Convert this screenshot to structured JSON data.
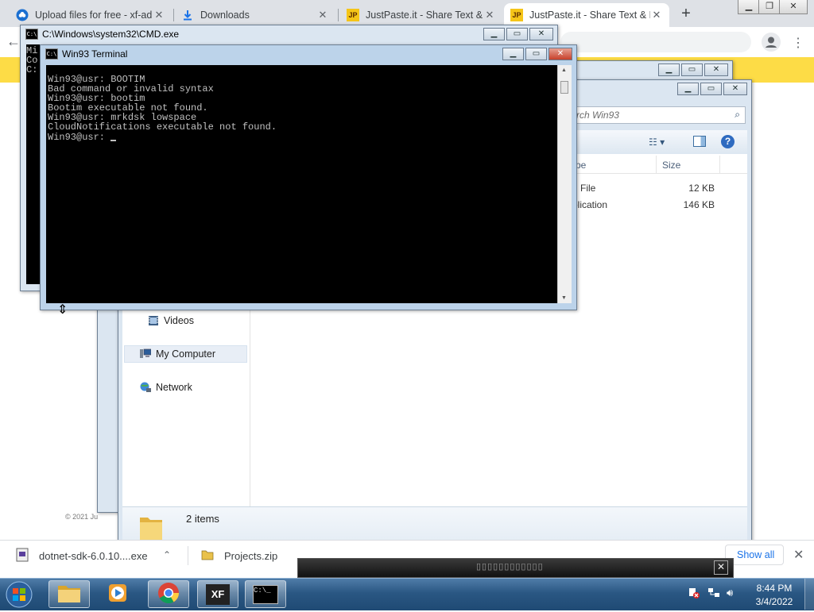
{
  "browser": {
    "tabs": [
      {
        "title": "Upload files for free - xf-ad",
        "favicon": "upload-cloud-icon"
      },
      {
        "title": "Downloads",
        "favicon": "download-icon"
      },
      {
        "title": "JustPaste.it - Share Text & I",
        "favicon": "JP"
      },
      {
        "title": "JustPaste.it - Share Text & I",
        "favicon": "JP"
      }
    ],
    "new_tab": "+",
    "page_footer": "© 2021 Ju"
  },
  "cmd_window": {
    "title": "C:\\Windows\\system32\\CMD.exe",
    "visible_lines": [
      "Mi",
      "Co",
      "",
      "C:"
    ]
  },
  "terminal_window": {
    "title": "Win93 Terminal",
    "lines": [
      "Win93@usr: BOOTIM",
      "Bad command or invalid syntax",
      "Win93@usr: bootim",
      "Bootim executable not found.",
      "Win93@usr: mrkdsk lowspace",
      "CloudNotifications executable not found.",
      "Win93@usr: "
    ]
  },
  "explorer_window": {
    "search_placeholder": "rch Win93",
    "columns": {
      "type": "pe",
      "size": "Size"
    },
    "rows": [
      {
        "type": "File",
        "size": "12 KB"
      },
      {
        "type": "plication",
        "size": "146 KB"
      }
    ],
    "nav_items": [
      "Videos",
      "My Computer",
      "Network"
    ],
    "status": "2 items"
  },
  "download_bar": {
    "items": [
      "dotnet-sdk-6.0.10....exe",
      "Projects.zip"
    ],
    "show_all": "Show all"
  },
  "overlay_text": "▯▯▯▯▯▯▯▯▯▯▯▯",
  "taskbar": {
    "apps": [
      "explorer-icon",
      "media-player-icon",
      "chrome-icon",
      "xf-app-icon",
      "cmd-icon"
    ],
    "xf_label": "XF",
    "time": "8:44 PM",
    "date": "3/4/2022"
  }
}
